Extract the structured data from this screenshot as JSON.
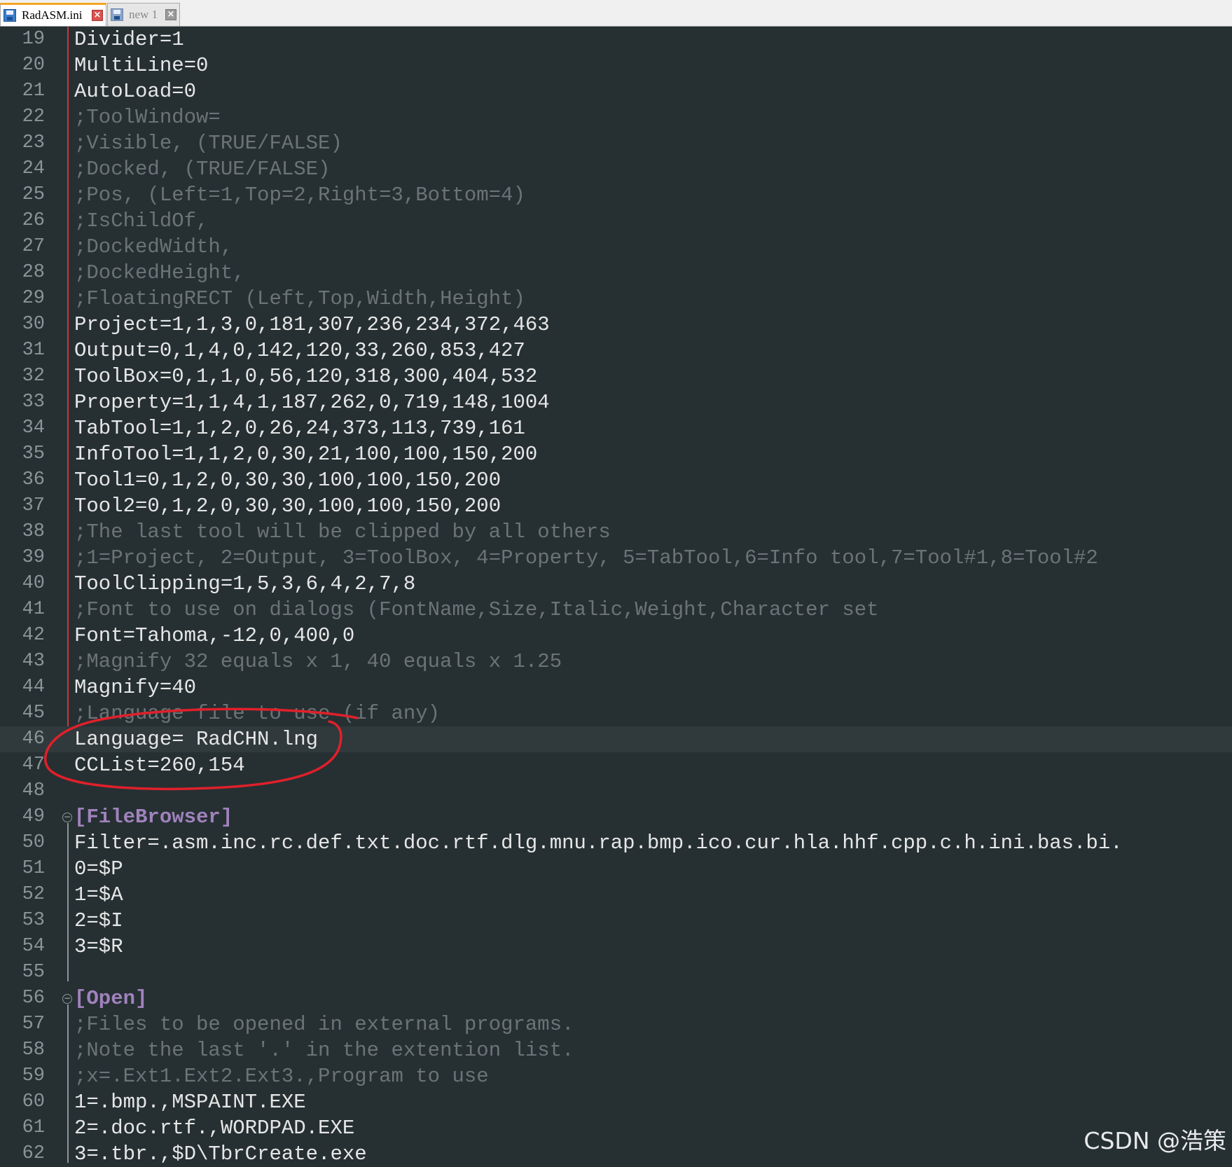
{
  "tabs": [
    {
      "label": "RadASM.ini",
      "active": true
    },
    {
      "label": "new 1",
      "active": false
    }
  ],
  "editor": {
    "current_line": 46,
    "lines": [
      {
        "num": "19",
        "text": "Divider=1",
        "type": "code"
      },
      {
        "num": "20",
        "text": "MultiLine=0",
        "type": "code"
      },
      {
        "num": "21",
        "text": "AutoLoad=0",
        "type": "code"
      },
      {
        "num": "22",
        "text": ";ToolWindow=",
        "type": "comment"
      },
      {
        "num": "23",
        "text": ";Visible, (TRUE/FALSE)",
        "type": "comment"
      },
      {
        "num": "24",
        "text": ";Docked, (TRUE/FALSE)",
        "type": "comment"
      },
      {
        "num": "25",
        "text": ";Pos, (Left=1,Top=2,Right=3,Bottom=4)",
        "type": "comment"
      },
      {
        "num": "26",
        "text": ";IsChildOf,",
        "type": "comment"
      },
      {
        "num": "27",
        "text": ";DockedWidth,",
        "type": "comment"
      },
      {
        "num": "28",
        "text": ";DockedHeight,",
        "type": "comment"
      },
      {
        "num": "29",
        "text": ";FloatingRECT (Left,Top,Width,Height)",
        "type": "comment"
      },
      {
        "num": "30",
        "text": "Project=1,1,3,0,181,307,236,234,372,463",
        "type": "code"
      },
      {
        "num": "31",
        "text": "Output=0,1,4,0,142,120,33,260,853,427",
        "type": "code"
      },
      {
        "num": "32",
        "text": "ToolBox=0,1,1,0,56,120,318,300,404,532",
        "type": "code"
      },
      {
        "num": "33",
        "text": "Property=1,1,4,1,187,262,0,719,148,1004",
        "type": "code"
      },
      {
        "num": "34",
        "text": "TabTool=1,1,2,0,26,24,373,113,739,161",
        "type": "code"
      },
      {
        "num": "35",
        "text": "InfoTool=1,1,2,0,30,21,100,100,150,200",
        "type": "code"
      },
      {
        "num": "36",
        "text": "Tool1=0,1,2,0,30,30,100,100,150,200",
        "type": "code"
      },
      {
        "num": "37",
        "text": "Tool2=0,1,2,0,30,30,100,100,150,200",
        "type": "code"
      },
      {
        "num": "38",
        "text": ";The last tool will be clipped by all others",
        "type": "comment"
      },
      {
        "num": "39",
        "text": ";1=Project, 2=Output, 3=ToolBox, 4=Property, 5=TabTool,6=Info tool,7=Tool#1,8=Tool#2",
        "type": "comment"
      },
      {
        "num": "40",
        "text": "ToolClipping=1,5,3,6,4,2,7,8",
        "type": "code"
      },
      {
        "num": "41",
        "text": ";Font to use on dialogs (FontName,Size,Italic,Weight,Character set",
        "type": "comment"
      },
      {
        "num": "42",
        "text": "Font=Tahoma,-12,0,400,0",
        "type": "code"
      },
      {
        "num": "43",
        "text": ";Magnify 32 equals x 1, 40 equals x 1.25",
        "type": "comment"
      },
      {
        "num": "44",
        "text": "Magnify=40",
        "type": "code"
      },
      {
        "num": "45",
        "text": ";Language file to use (if any)",
        "type": "comment"
      },
      {
        "num": "46",
        "text": "Language= RadCHN.lng",
        "type": "code"
      },
      {
        "num": "47",
        "text": "CCList=260,154",
        "type": "code"
      },
      {
        "num": "48",
        "text": "",
        "type": "code"
      },
      {
        "num": "49",
        "text": "[FileBrowser]",
        "type": "section"
      },
      {
        "num": "50",
        "text": "Filter=.asm.inc.rc.def.txt.doc.rtf.dlg.mnu.rap.bmp.ico.cur.hla.hhf.cpp.c.h.ini.bas.bi.",
        "type": "code"
      },
      {
        "num": "51",
        "text": "0=$P",
        "type": "code"
      },
      {
        "num": "52",
        "text": "1=$A",
        "type": "code"
      },
      {
        "num": "53",
        "text": "2=$I",
        "type": "code"
      },
      {
        "num": "54",
        "text": "3=$R",
        "type": "code"
      },
      {
        "num": "55",
        "text": "",
        "type": "code"
      },
      {
        "num": "56",
        "text": "[Open]",
        "type": "section"
      },
      {
        "num": "57",
        "text": ";Files to be opened in external programs.",
        "type": "comment"
      },
      {
        "num": "58",
        "text": ";Note the last '.' in the extention list.",
        "type": "comment"
      },
      {
        "num": "59",
        "text": ";x=.Ext1.Ext2.Ext3.,Program to use",
        "type": "comment"
      },
      {
        "num": "60",
        "text": "1=.bmp.,MSPAINT.EXE",
        "type": "code"
      },
      {
        "num": "61",
        "text": "2=.doc.rtf.,WORDPAD.EXE",
        "type": "code"
      },
      {
        "num": "62",
        "text": "3=.tbr.,$D\\TbrCreate.exe",
        "type": "code"
      }
    ]
  },
  "watermark": "CSDN @浩策",
  "colors": {
    "background": "#263033",
    "code_text": "#e6e6e6",
    "comment_text": "#6b7376",
    "section_text": "#a082bd",
    "annotation_red": "#e0202a"
  }
}
